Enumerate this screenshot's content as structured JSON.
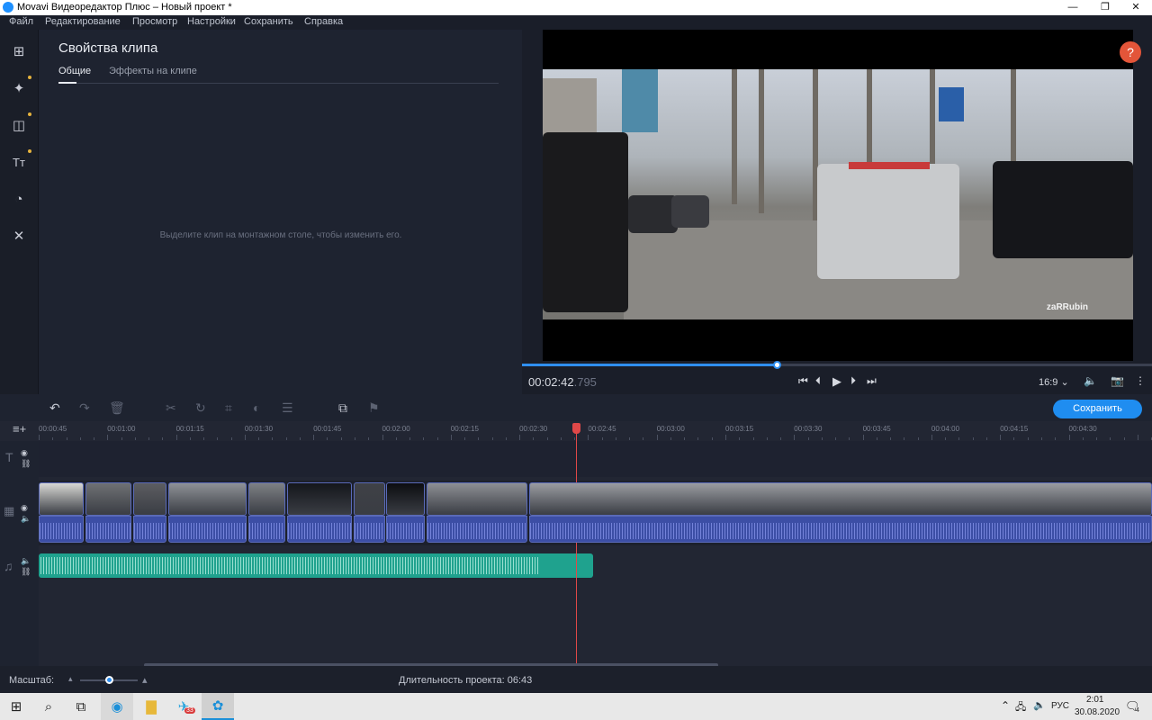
{
  "window": {
    "title": "Movavi Видеоредактор Плюс – Новый проект *",
    "minimize": "—",
    "maximize": "❐",
    "close": "✕"
  },
  "menu": [
    "Файл",
    "Редактирование",
    "Просмотр",
    "Настройки",
    "Сохранить",
    "Справка"
  ],
  "sidebar": {
    "items": [
      {
        "icon": "import-icon",
        "glyph": "⊞"
      },
      {
        "icon": "magic-wand-icon",
        "glyph": "✦"
      },
      {
        "icon": "transitions-icon",
        "glyph": "◫"
      },
      {
        "icon": "titles-icon",
        "glyph": "Tт"
      },
      {
        "icon": "stickers-icon",
        "glyph": "◔"
      },
      {
        "icon": "tools-icon",
        "glyph": "✕"
      }
    ]
  },
  "properties": {
    "title": "Свойства клипа",
    "tabs": [
      "Общие",
      "Эффекты на клипе"
    ],
    "hint": "Выделите клип на монтажном столе, чтобы изменить его."
  },
  "player": {
    "watermark": "zaRRubin",
    "help": "?",
    "timecode": "00:02:42",
    "timecode_ms": ".795",
    "progress": 0.405,
    "aspect": "16:9 ⌄",
    "controls": [
      "⏮",
      "⏴",
      "▶",
      "⏵",
      "⏭"
    ]
  },
  "timeline": {
    "save_label": "Сохранить",
    "ruler": [
      "00:00:45",
      "00:01:00",
      "00:01:15",
      "00:01:30",
      "00:01:45",
      "00:02:00",
      "00:02:15",
      "00:02:30",
      "00:02:45",
      "00:03:00",
      "00:03:15",
      "00:03:30",
      "00:03:45",
      "00:04:00",
      "00:04:15",
      "00:04:30"
    ],
    "playhead": "00:02:42"
  },
  "status": {
    "scale_label": "Масштаб:",
    "duration_label": "Длительность проекта:",
    "duration_value": "06:43"
  },
  "taskbar": {
    "lang": "РУС",
    "time": "2:01",
    "date": "30.08.2020",
    "badge": "33",
    "notif": "4"
  },
  "colors": {
    "accent": "#1f8df0",
    "playhead": "#e04848",
    "music": "#1fa28e",
    "clip_audio": "#3c4ea5"
  }
}
